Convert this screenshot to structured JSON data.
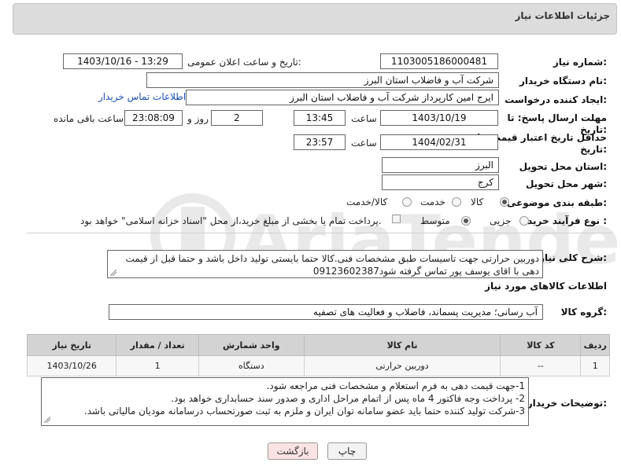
{
  "header": {
    "title": "جزئیات اطلاعات نیاز"
  },
  "form": {
    "need_number_label": "شماره نیاز:",
    "need_number": "1103005186000481",
    "announce_label": "تاریخ و ساعت اعلان عمومی:",
    "announce_value": "1403/10/16 - 13:29",
    "buyer_org_label": "نام دستگاه خریدار:",
    "buyer_org": "شرکت آب و فاضلاب استان البرز",
    "creator_label": "ایجاد کننده درخواست:",
    "creator": "ایرج امین کارپرداز شرکت آب و فاضلاب استان البرز",
    "buyer_contact_link": "اطلاعات تماس خریدار",
    "deadline_label_1": "مهلت ارسال پاسخ: تا",
    "deadline_label_2": "تاریخ:",
    "deadline_date": "1403/10/19",
    "time_label": "ساعت",
    "deadline_time": "13:45",
    "days_value": "2",
    "days_label": "روز و",
    "remaining_time": "23:08:09",
    "remaining_label": "ساعت باقی مانده",
    "validity_label_1": "حداقل تاریخ اعتبار قیمت: تا",
    "validity_label_2": "تاریخ:",
    "validity_date": "1404/02/31",
    "validity_time": "23:57",
    "province_label": "استان محل تحویل:",
    "province": "البرز",
    "city_label": "شهر محل تحویل:",
    "city": "کرج",
    "category_label": "طبقه بندی موضوعی:",
    "category_options": [
      "کالا",
      "خدمت",
      "کالا/خدمت"
    ],
    "process_label": "نوع فرآیند خرید :",
    "process_options": [
      "جزیی",
      "متوسط"
    ],
    "process_note": "پرداخت تمام یا بخشی از مبلغ خرید،از محل \"اسناد خزانه اسلامی\" خواهد بود."
  },
  "description": {
    "label": "شرح کلی نیاز:",
    "text": "دوربین حرارتی جهت تاسیسات طبق مشخصات فنی.کالا حتما بایستی تولید داخل باشد و حتما قبل از قیمت دهی با اقای  یوسف پور تماس گرفته شود09123602387"
  },
  "goods_section": {
    "title": "اطلاعات کالاهای مورد نیاز",
    "group_label": "گروه کالا:",
    "group_value": "آب رسانی؛ مدیریت پسماند، فاضلاب و فعالیت های تصفیه"
  },
  "table": {
    "headers": [
      "ردیف",
      "کد کالا",
      "نام کالا",
      "واحد شمارش",
      "تعداد / مقدار",
      "تاریخ نیاز"
    ],
    "rows": [
      [
        "1",
        "--",
        "دوربین حرارتی",
        "دستگاه",
        "1",
        "1403/10/26"
      ]
    ]
  },
  "buyer_notes": {
    "label": "توضیحات خریدار:",
    "lines": [
      "1-جهت قیمت دهی به فرم استعلام و مشخصات فنی مراجعه شود.",
      "2- پرداخت وجه فاکتور 4 ماه پس از اتمام مراحل اداری و صدور سند حسابداری خواهد بود.",
      "3-شرکت تولید کننده حتما باید عضو سامانه توان ایران و ملزم به ثبت صورتحساب درسامانه مودیان مالیاتی باشد."
    ]
  },
  "buttons": {
    "print": "چاپ",
    "back": "بازگشت"
  },
  "watermark": {
    "text": "AriaTender.neT"
  },
  "colors": {
    "link": "#1a4fb8",
    "back_button_bg": "#fbe3e3",
    "header_bg": "#dcdcdc"
  }
}
